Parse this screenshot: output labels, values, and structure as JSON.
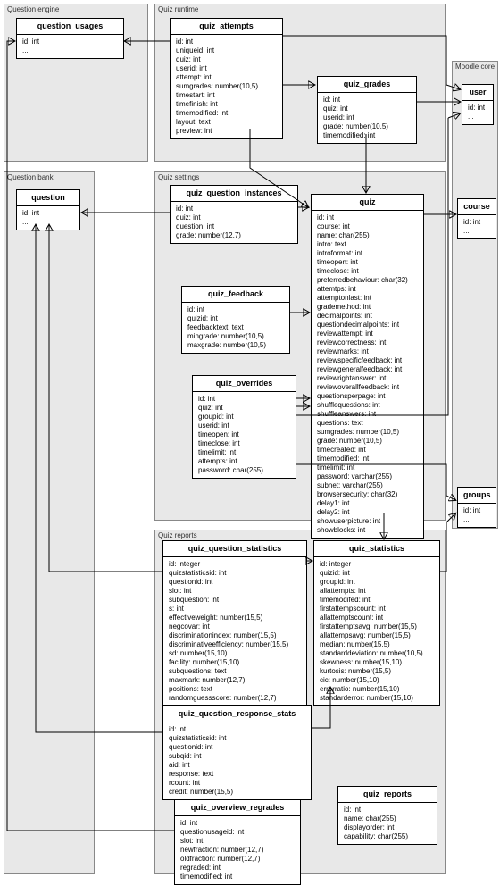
{
  "groups": {
    "qengine": "Question engine",
    "qbank": "Question bank",
    "runtime": "Quiz runtime",
    "settings": "Quiz settings",
    "reports": "Quiz reports",
    "core": "Moodle core"
  },
  "entities": {
    "question_usages": {
      "title": "question_usages",
      "fields": [
        "id: int",
        "..."
      ]
    },
    "question": {
      "title": "question",
      "fields": [
        "id: int",
        "..."
      ]
    },
    "quiz_attempts": {
      "title": "quiz_attempts",
      "fields": [
        "id: int",
        "uniqueid: int",
        "quiz: int",
        "userid: int",
        "attempt: int",
        "sumgrades: number(10,5)",
        "timestart: int",
        "timefinish: int",
        "timemodified: int",
        "layout: text",
        "preview: int"
      ]
    },
    "quiz_grades": {
      "title": "quiz_grades",
      "fields": [
        "id: int",
        "quiz: int",
        "userid: int",
        "grade: number(10,5)",
        "timemodified: int"
      ]
    },
    "qqi": {
      "title": "quiz_question_instances",
      "fields": [
        "id: int",
        "quiz: int",
        "question: int",
        "grade: number(12,7)"
      ]
    },
    "quiz_feedback": {
      "title": "quiz_feedback",
      "fields": [
        "id: int",
        "quizid: int",
        "feedbacktext: text",
        "mingrade: number(10,5)",
        "maxgrade: number(10,5)"
      ]
    },
    "quiz_overrides": {
      "title": "quiz_overrides",
      "fields": [
        "id: int",
        "quiz: int",
        "groupid: int",
        "userid: int",
        "timeopen: int",
        "timeclose: int",
        "timelimit: int",
        "attempts: int",
        "password: char(255)"
      ]
    },
    "quiz": {
      "title": "quiz",
      "fields": [
        "id: int",
        "course: int",
        "name: char(255)",
        "intro: text",
        "introformat: int",
        "timeopen: int",
        "timeclose: int",
        "preferredbehaviour: char(32)",
        "attemtps: int",
        "attemptonlast: int",
        "grademethod: int",
        "decimalpoints: int",
        "questiondecimalpoints: int",
        "reviewattempt: int",
        "reviewcorrectness: int",
        "reviewmarks: int",
        "reviewspecificfeedback: int",
        "reviewgeneralfeedback: int",
        "reviewrightanswer: int",
        "reviewoverallfeedback: int",
        "questionsperpage: int",
        "shufflequestions: int",
        "shuffleanswers: int",
        "questions: text",
        "sumgrades: number(10,5)",
        "grade: number(10,5)",
        "timecreated: int",
        "timemodified: int",
        "timelimit: int",
        "password: varchar(255)",
        "subnet: varchar(255)",
        "browsersecurity: char(32)",
        "delay1: int",
        "delay2: int",
        "showuserpicture: int",
        "showblocks: int"
      ]
    },
    "user": {
      "title": "user",
      "fields": [
        "id: int",
        "..."
      ]
    },
    "course": {
      "title": "course",
      "fields": [
        "id: int",
        "..."
      ]
    },
    "groups_e": {
      "title": "groups",
      "fields": [
        "id: int",
        "..."
      ]
    },
    "qqstats": {
      "title": "quiz_question_statistics",
      "fields": [
        "id: integer",
        "quizstatisticsid: int",
        "questionid: int",
        "slot: int",
        "subquestion: int",
        "s: int",
        "effectiveweight: number(15,5)",
        "negcovar: int",
        "discriminationindex: number(15,5)",
        "discriminativeefficiency: number(15,5)",
        "sd: number(15,10)",
        "facility: number(15,10)",
        "subquestions: text",
        "maxmark: number(12,7)",
        "positions: text",
        "randomguessscore: number(12,7)"
      ]
    },
    "qstats": {
      "title": "quiz_statistics",
      "fields": [
        "id: integer",
        "quizid: int",
        "groupid: int",
        "allattempts: int",
        "timemodifed: int",
        "firstattempscount: int",
        "allattemptscount: int",
        "firstattemptsavg: number(15,5)",
        "allattempsavg: number(15,5)",
        "median: number(15,5)",
        "standarddeviation: number(10,5)",
        "skewness: number(15,10)",
        "kurtosis: number(15,5)",
        "cic: number(15,10)",
        "errorratio: number(15,10)",
        "standarderror: number(15,10)"
      ]
    },
    "qqresp": {
      "title": "quiz_question_response_stats",
      "fields": [
        "id: int",
        "quizstatisticsid: int",
        "questionid: int",
        "subqid: int",
        "aid: int",
        "response: text",
        "rcount: int",
        "credit: number(15,5)"
      ]
    },
    "qreports": {
      "title": "quiz_reports",
      "fields": [
        "id: int",
        "name: char(255)",
        "displayorder: int",
        "capability: char(255)"
      ]
    },
    "qoverview": {
      "title": "quiz_overview_regrades",
      "fields": [
        "id: int",
        "questionusageid: int",
        "slot: int",
        "newfraction: number(12,7)",
        "oldfraction: number(12,7)",
        "regraded: int",
        "timemodified: int"
      ]
    }
  }
}
